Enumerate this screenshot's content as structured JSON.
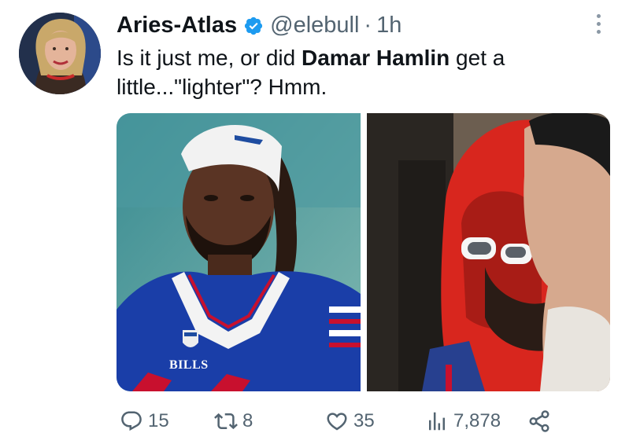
{
  "author": {
    "display_name": "Aries-Atlas",
    "handle": "@elebull",
    "separator": "·",
    "time": "1h",
    "verified": true,
    "verified_color": "#1d9bf0"
  },
  "tweet": {
    "text_before": "Is it just me, or did ",
    "text_bold": "Damar Hamlin",
    "text_after": " get a little...\"lighter\"? Hmm."
  },
  "media": {
    "left_photo": {
      "jersey_text": "BILLS"
    }
  },
  "actions": {
    "reply_count": "15",
    "retweet_count": "8",
    "like_count": "35",
    "views_count": "7,878"
  },
  "icons": {
    "more": "more-vertical-icon",
    "reply": "reply-icon",
    "retweet": "retweet-icon",
    "like": "heart-icon",
    "views": "views-icon",
    "share": "share-icon",
    "verified": "verified-badge-icon"
  },
  "colors": {
    "text": "#0f1419",
    "secondary": "#536471",
    "accent": "#1d9bf0"
  }
}
